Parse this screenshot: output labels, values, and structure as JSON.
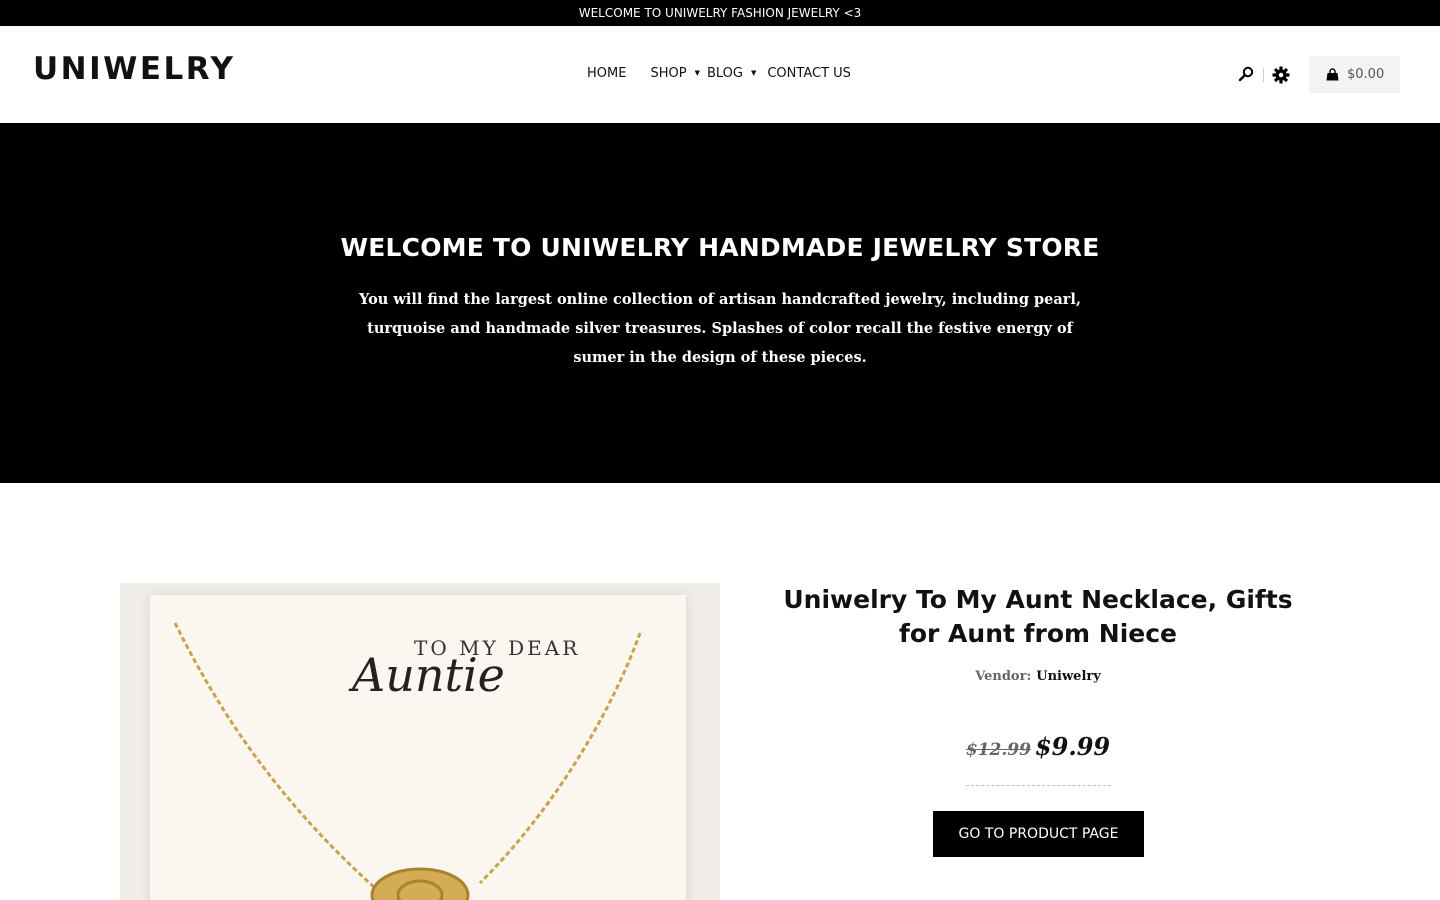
{
  "announcement": "WELCOME TO UNIWELRY FASHION JEWELRY <3",
  "header": {
    "logo": "UNIWELRY",
    "nav": [
      {
        "label": "HOME"
      },
      {
        "label": "SHOP",
        "has_dropdown": true
      },
      {
        "label": "BLOG",
        "has_dropdown": true
      },
      {
        "label": "CONTACT US"
      }
    ],
    "icons": [
      "search-icon",
      "gear-icon",
      "shopping-bag-icon"
    ],
    "cart_total": "$0.00"
  },
  "hero": {
    "title": "WELCOME TO UNIWELRY HANDMADE JEWELRY STORE",
    "description": "You will find the largest online collection of artisan handcrafted jewelry, including pearl, turquoise and handmade silver treasures. Splashes of color recall the festive energy of sumer in the design of these pieces."
  },
  "product": {
    "image_text_line1": "TO MY DEAR",
    "image_text_line2": "Auntie",
    "title": "Uniwelry To My Aunt Necklace, Gifts for Aunt from Niece",
    "vendor_label": "Vendor:",
    "vendor_name": "Uniwelry",
    "price_old": "$12.99",
    "price_new": "$9.99",
    "cta_label": "GO TO PRODUCT PAGE"
  },
  "colors": {
    "dark": "#000000",
    "background": "#ffffff",
    "cart_bg": "#f3f3f3",
    "gold": "#c9a24a"
  }
}
